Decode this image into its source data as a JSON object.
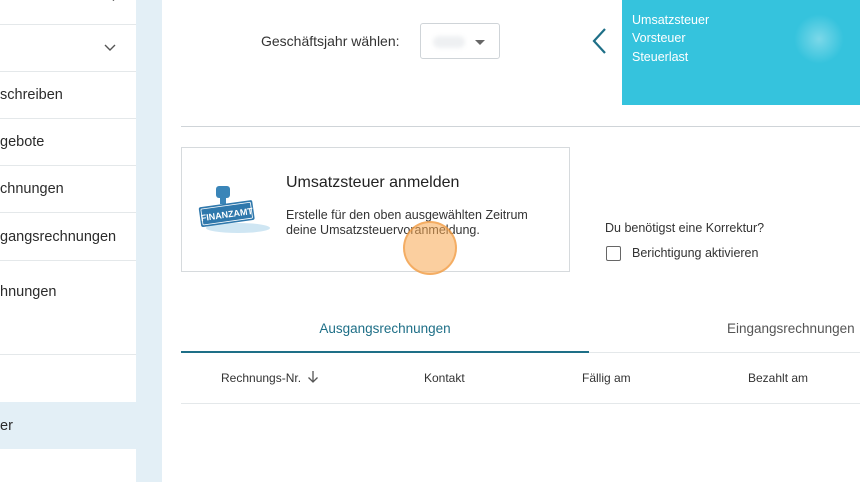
{
  "sidebar": {
    "items": [
      {
        "label": "",
        "has_chevron": true,
        "chevron": "›"
      },
      {
        "label": "",
        "has_chevron": true,
        "chevron": "⌄"
      },
      {
        "label": "schreiben"
      },
      {
        "label": "gebote"
      },
      {
        "label": "chnungen"
      },
      {
        "label": "gangsrechnungen"
      },
      {
        "label": "hnungen"
      },
      {
        "label": ""
      },
      {
        "label": "er"
      }
    ]
  },
  "fiscal_year": {
    "label": "Geschäftsjahr wählen:",
    "selected": ""
  },
  "summary_card": {
    "lines": [
      "Umsatzsteuer",
      "Vorsteuer",
      "Steuerlast"
    ],
    "color": "#35c3dd"
  },
  "tax_card": {
    "title": "Umsatzsteuer anmelden",
    "desc_line1": "Erstelle für den oben ausgewählten Zeitrum",
    "desc_line2": "deine Umsatzsteuervoranmeldung.",
    "stamp_text": "FINANZAMT"
  },
  "correction": {
    "question": "Du benötigst eine Korrektur?",
    "checkbox_label": "Berichtigung aktivieren"
  },
  "tabs": [
    {
      "label": "Ausgangsrechnungen",
      "active": true
    },
    {
      "label": "Eingangsrechnungen",
      "active": false
    }
  ],
  "table": {
    "columns": [
      "Rechnungs-Nr.",
      "Kontakt",
      "Fällig am",
      "Bezahlt am"
    ]
  },
  "colors": {
    "accent": "#1e6f87",
    "teal": "#35c3dd",
    "sidebar_active": "#e3eff6"
  }
}
